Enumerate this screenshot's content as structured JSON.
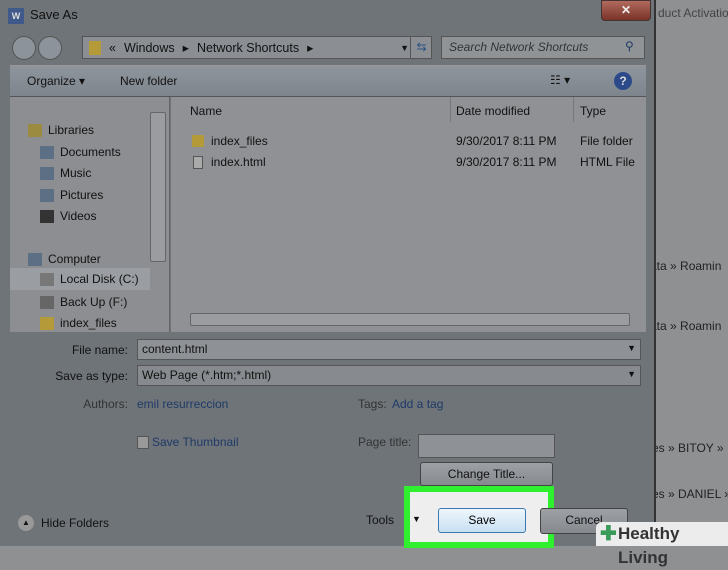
{
  "background_texts": [
    "duct Activatio",
    "ata » Roamin",
    "ata » Roamin",
    "es » BITOY »",
    "es » DANIEL »"
  ],
  "dialog": {
    "title": "Save As",
    "app_icon": "W"
  },
  "address": {
    "path": [
      "«",
      "Windows",
      "Network Shortcuts"
    ],
    "search_placeholder": "Search Network Shortcuts"
  },
  "toolbar": {
    "organize": "Organize",
    "new_folder": "New folder"
  },
  "nav": [
    {
      "label": "Libraries",
      "icon": "libraries-icon"
    },
    {
      "label": "Documents",
      "icon": "documents-icon"
    },
    {
      "label": "Music",
      "icon": "music-icon"
    },
    {
      "label": "Pictures",
      "icon": "pictures-icon"
    },
    {
      "label": "Videos",
      "icon": "videos-icon"
    },
    {
      "label": "Computer",
      "icon": "computer-icon"
    },
    {
      "label": "Local Disk (C:)",
      "icon": "disk-icon"
    },
    {
      "label": "Back Up (F:)",
      "icon": "drive-icon"
    },
    {
      "label": "index_files",
      "icon": "folder-icon"
    }
  ],
  "columns": {
    "name": "Name",
    "date": "Date modified",
    "type": "Type"
  },
  "files": [
    {
      "name": "index_files",
      "date": "9/30/2017 8:11 PM",
      "type": "File folder"
    },
    {
      "name": "index.html",
      "date": "9/30/2017 8:11 PM",
      "type": "HTML File"
    }
  ],
  "form": {
    "file_name_label": "File name:",
    "file_name": "content.html",
    "type_label": "Save as type:",
    "type_value": "Web Page (*.htm;*.html)",
    "authors_label": "Authors:",
    "authors": "emil resurreccion",
    "tags_label": "Tags:",
    "tags": "Add a tag",
    "thumbnail": "Save Thumbnail",
    "page_title_label": "Page title:",
    "page_title": "",
    "change_title": "Change Title..."
  },
  "footer": {
    "hide_folders": "Hide Folders",
    "tools": "Tools",
    "save": "Save",
    "cancel": "Cancel"
  },
  "watermark": "Healthy Living"
}
